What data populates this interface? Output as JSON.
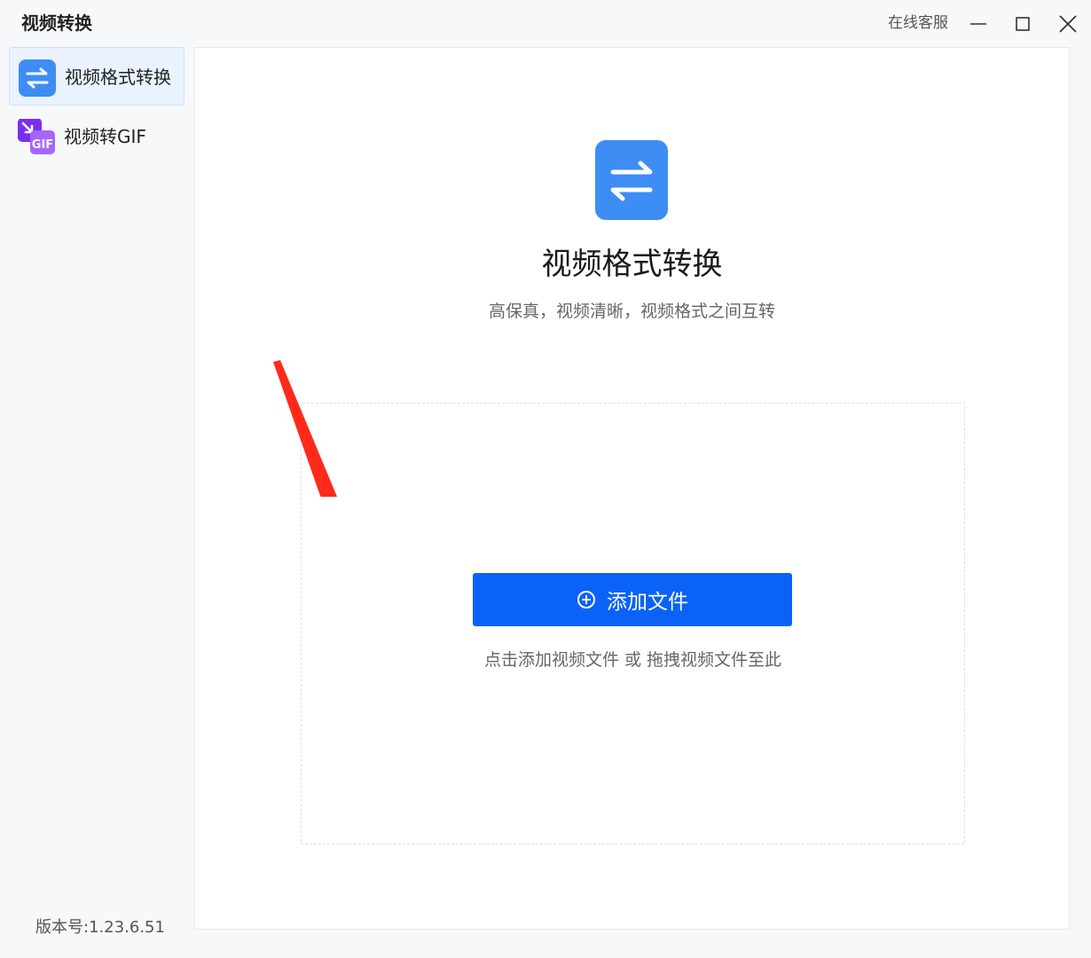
{
  "app": {
    "title": "视频转换",
    "support_label": "在线客服"
  },
  "sidebar": {
    "items": [
      {
        "label": "视频格式转换",
        "icon": "swap-arrows-icon",
        "active": true
      },
      {
        "label": "视频转GIF",
        "icon": "gif-icon",
        "active": false
      }
    ],
    "version": "版本号:1.23.6.51"
  },
  "main": {
    "title": "视频格式转换",
    "subtitle": "高保真，视频清晰，视频格式之间互转",
    "add_button_label": "添加文件",
    "drop_hint": "点击添加视频文件 或 拖拽视频文件至此",
    "gif_icon_text": "GIF"
  },
  "colors": {
    "primary": "#0a63f6",
    "icon_blue": "#3d8df5",
    "gif_purple": "#8a3ffc",
    "annotation_red": "#ff2a1a"
  }
}
